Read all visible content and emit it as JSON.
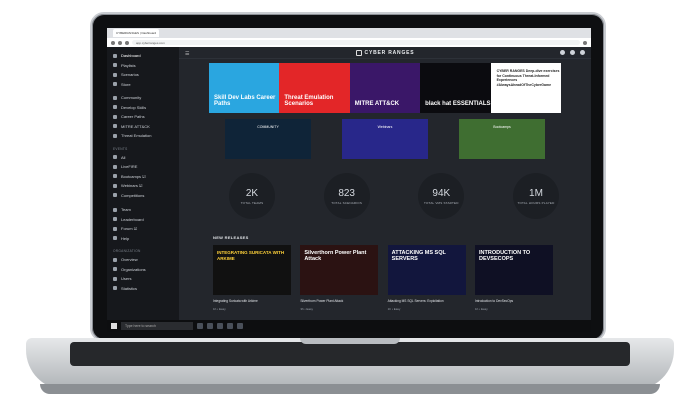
{
  "browser": {
    "tab_title": "CYBERRANGES | Dashboard",
    "url": "app.cyberranges.com"
  },
  "app": {
    "brand": "CYBER RANGES"
  },
  "sidebar": {
    "items": [
      {
        "label": "Dashboard",
        "active": true
      },
      {
        "label": "Playlists"
      },
      {
        "label": "Scenarios"
      },
      {
        "label": "Store"
      },
      {
        "label": "Community"
      },
      {
        "label": "Develop Skills"
      },
      {
        "label": "Career Paths"
      },
      {
        "label": "MITRE ATT&CK"
      },
      {
        "label": "Threat Emulation"
      }
    ],
    "events_heading": "EVENTS",
    "events": [
      {
        "label": "All"
      },
      {
        "label": "LiveFIRE"
      },
      {
        "label": "Bootcamps ☑"
      },
      {
        "label": "Webinars ☑"
      },
      {
        "label": "Competitions"
      }
    ],
    "team_items": [
      {
        "label": "Team"
      },
      {
        "label": "Leaderboard"
      },
      {
        "label": "Forum ☑"
      },
      {
        "label": "Help"
      }
    ],
    "org_heading": "ORGANIZATION",
    "org_items": [
      {
        "label": "Overview"
      },
      {
        "label": "Organizations"
      },
      {
        "label": "Users"
      },
      {
        "label": "Statistics"
      }
    ]
  },
  "banners": [
    {
      "text": "Skill Dev Labs Career Paths"
    },
    {
      "text": "Threat Emulation Scenarios"
    },
    {
      "text": "MITRE ATT&CK"
    },
    {
      "text": "black hat ESSENTIALS"
    },
    {
      "text": "CYBER RANGES Deep-dive exercises for Continuous Threat-Informed Experiences #AlwaysAheadOfTheCyberGame"
    }
  ],
  "thumbs": [
    {
      "label": "COMMUNITY"
    },
    {
      "label": "Webinars"
    },
    {
      "label": "Bootcamps"
    }
  ],
  "stats": [
    {
      "value": "2K",
      "label": "TOTAL TEAMS"
    },
    {
      "value": "823",
      "label": "TOTAL SCENARIOS"
    },
    {
      "value": "94K",
      "label": "TOTAL VMS STARTED"
    },
    {
      "value": "1M",
      "label": "TOTAL HOURS PLAYED"
    }
  ],
  "new_releases": {
    "title": "NEW RELEASES",
    "items": [
      {
        "art_text": "INTEGRATING SURICATA WITH ARKIME",
        "name": "Integrating Suricata with Arkime",
        "meta": "1h • Easy"
      },
      {
        "art_text": "Silverthorn Power Plant Attack",
        "name": "Silverthorn Power Plant Attack",
        "meta": "3h • Easy"
      },
      {
        "art_text": "ATTACKING MS SQL SERVERS",
        "name": "Attacking MS SQL Servers: Exploitation",
        "meta": "1h • Easy"
      },
      {
        "art_text": "INTRODUCTION TO DEVSECOPS",
        "name": "Introduction to DevSecOps",
        "meta": "1h • Easy"
      }
    ]
  },
  "taskbar": {
    "search_placeholder": "Type here to search"
  }
}
